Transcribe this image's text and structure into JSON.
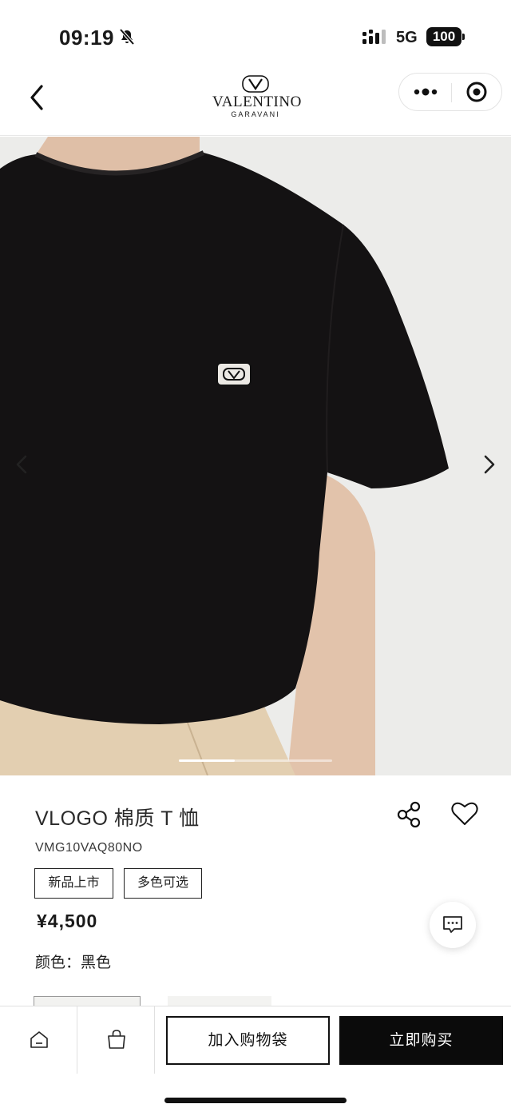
{
  "status_bar": {
    "time": "09:19",
    "network": "5G",
    "battery": "100",
    "icons": [
      "bell-slash-icon",
      "signal-icon",
      "battery-icon"
    ]
  },
  "nav": {
    "brand_name": "VALENTINO",
    "brand_sub": "GARAVANI",
    "icons": [
      "chevron-left-icon",
      "more-dots-icon",
      "target-close-icon"
    ]
  },
  "gallery": {
    "icons": [
      "chevron-left-icon",
      "chevron-right-icon"
    ]
  },
  "product": {
    "title": "VLOGO 棉质 T 恤",
    "code": "VMG10VAQ80NO",
    "tags": [
      "新品上市",
      "多色可选"
    ],
    "price": "¥4,500",
    "color_label": "颜色：",
    "color_value": "黑色",
    "icons": [
      "share-icon",
      "heart-icon",
      "chat-bubble-icon"
    ]
  },
  "bottom_bar": {
    "add_to_bag": "加入购物袋",
    "buy_now": "立即购买",
    "icons": [
      "home-icon",
      "shopping-bag-icon"
    ]
  },
  "colors": {
    "shirt": "#141213",
    "background": "#ececea",
    "skin": "#e2c3ab",
    "pants": "#e3cfb1",
    "buy_button": "#0b0b0b"
  }
}
